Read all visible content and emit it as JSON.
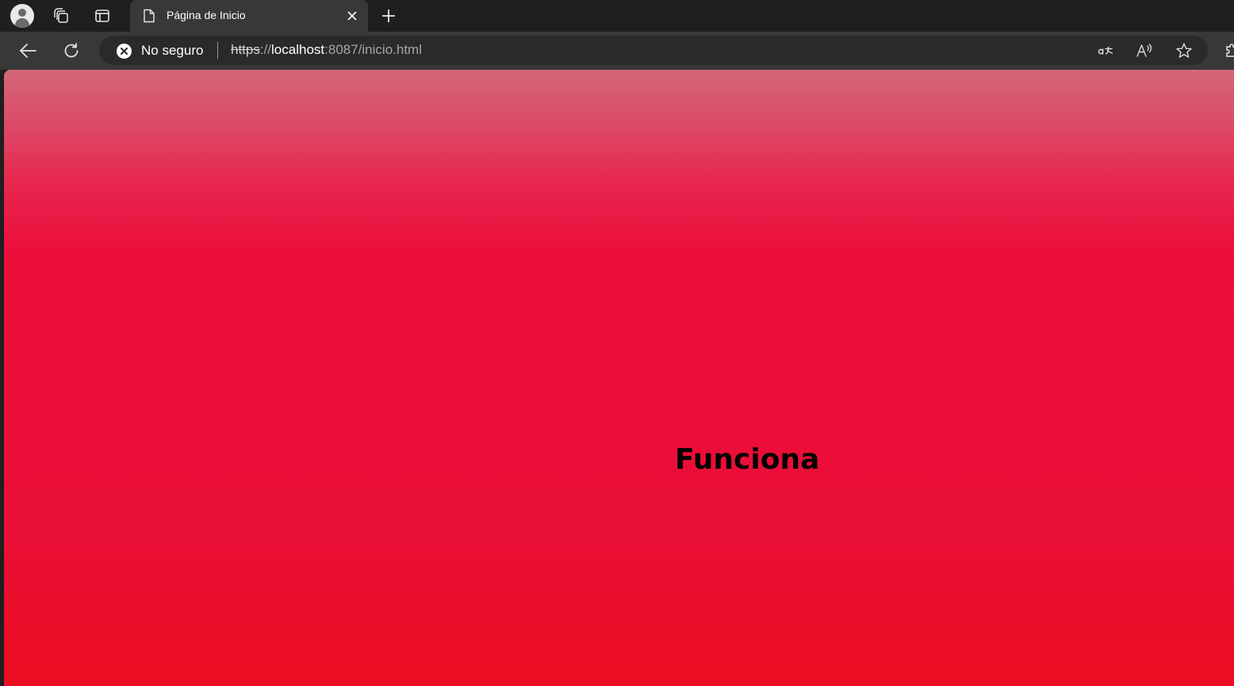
{
  "browser": {
    "tab": {
      "title": "Página de Inicio"
    },
    "address_bar": {
      "security_label": "No seguro",
      "url_scheme": "https",
      "url_separator": "://",
      "url_host": "localhost",
      "url_rest": ":8087/inicio.html"
    },
    "icons": {
      "profile": "profile-avatar-icon",
      "collections": "collections-icon",
      "vertical_tabs": "vertical-tabs-icon",
      "tab_page": "document-icon",
      "tab_close": "close-icon",
      "new_tab": "plus-icon",
      "back": "back-arrow-icon",
      "reload": "reload-icon",
      "not_secure": "not-secure-icon",
      "translate": "translate-icon",
      "read_aloud": "read-aloud-icon",
      "favorite": "star-icon",
      "extensions": "extensions-icon"
    }
  },
  "page": {
    "heading": "Funciona",
    "colors": {
      "gradient_top": "#d26877",
      "gradient_middle": "#ec0d3b",
      "gradient_bottom": "#eb0d20",
      "heading": "#000000"
    }
  }
}
